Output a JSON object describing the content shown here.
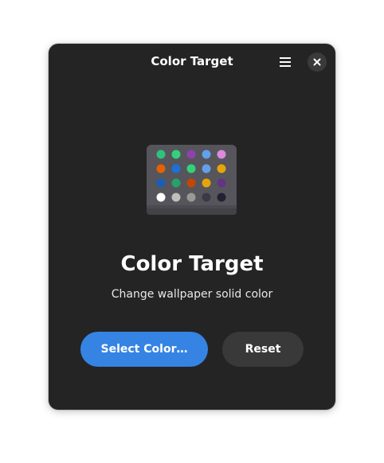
{
  "window": {
    "title": "Color Target"
  },
  "header": {
    "menu_icon": "hamburger-menu-icon",
    "close_icon": "close-icon"
  },
  "app": {
    "icon": "color-palette-icon",
    "name": "Color Target",
    "description": "Change wallpaper solid color"
  },
  "actions": {
    "select_label": "Select Color…",
    "reset_label": "Reset"
  },
  "palette": {
    "rows": [
      [
        "#2ec27e",
        "#33d17a",
        "#9141ac",
        "#62a0ea",
        "#dc8add"
      ],
      [
        "#e66100",
        "#1c71d8",
        "#33d17a",
        "#62a0ea",
        "#e5a50a"
      ],
      [
        "#1a5fb4",
        "#26a269",
        "#c64600",
        "#e5a50a",
        "#613583"
      ],
      [
        "#ffffff",
        "#c0bfbc",
        "#9a9996",
        "#3d3846",
        "#241f31"
      ]
    ]
  },
  "colors": {
    "accent": "#3584e4",
    "window_bg": "#242424",
    "reset_bg": "#393939"
  }
}
